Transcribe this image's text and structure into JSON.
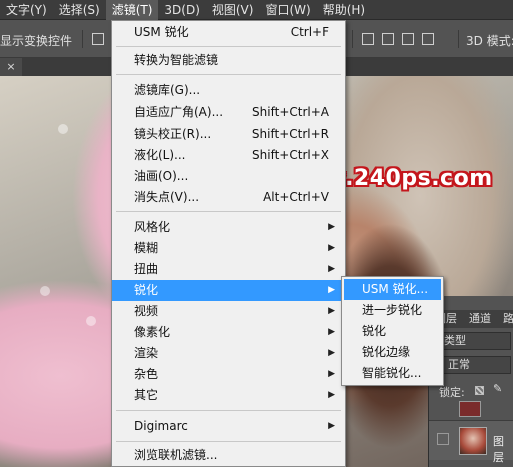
{
  "menubar": {
    "items": [
      "文字(Y)",
      "选择(S)",
      "滤镜(T)",
      "3D(D)",
      "视图(V)",
      "窗口(W)",
      "帮助(H)"
    ],
    "active_index": 2
  },
  "options_bar": {
    "show_transform_label": "显示变换控件",
    "mode_3d_label": "3D 模式:"
  },
  "tabbar": {
    "close_glyph": "×"
  },
  "watermark": "www.240ps.com",
  "filter_menu": {
    "items": [
      {
        "label": "USM 锐化",
        "shortcut": "Ctrl+F"
      },
      {
        "label": "转换为智能滤镜"
      },
      {
        "label": "滤镜库(G)..."
      },
      {
        "label": "自适应广角(A)...",
        "shortcut": "Shift+Ctrl+A"
      },
      {
        "label": "镜头校正(R)...",
        "shortcut": "Shift+Ctrl+R"
      },
      {
        "label": "液化(L)...",
        "shortcut": "Shift+Ctrl+X"
      },
      {
        "label": "油画(O)..."
      },
      {
        "label": "消失点(V)...",
        "shortcut": "Alt+Ctrl+V"
      },
      {
        "label": "风格化",
        "submenu": true
      },
      {
        "label": "模糊",
        "submenu": true
      },
      {
        "label": "扭曲",
        "submenu": true
      },
      {
        "label": "锐化",
        "submenu": true,
        "highlighted": true
      },
      {
        "label": "视频",
        "submenu": true
      },
      {
        "label": "像素化",
        "submenu": true
      },
      {
        "label": "渲染",
        "submenu": true
      },
      {
        "label": "杂色",
        "submenu": true
      },
      {
        "label": "其它",
        "submenu": true
      },
      {
        "label": "Digimarc",
        "submenu": true
      },
      {
        "label": "浏览联机滤镜..."
      }
    ]
  },
  "sharpen_submenu": {
    "items": [
      "USM 锐化...",
      "进一步锐化",
      "锐化",
      "锐化边缘",
      "智能锐化..."
    ],
    "highlighted_index": 0
  },
  "layers_panel": {
    "tabs": [
      "图层",
      "通道",
      "路"
    ],
    "filter_label": "类型",
    "blend_mode": "正常",
    "lock_label": "锁定:",
    "layer_name": "图层"
  }
}
